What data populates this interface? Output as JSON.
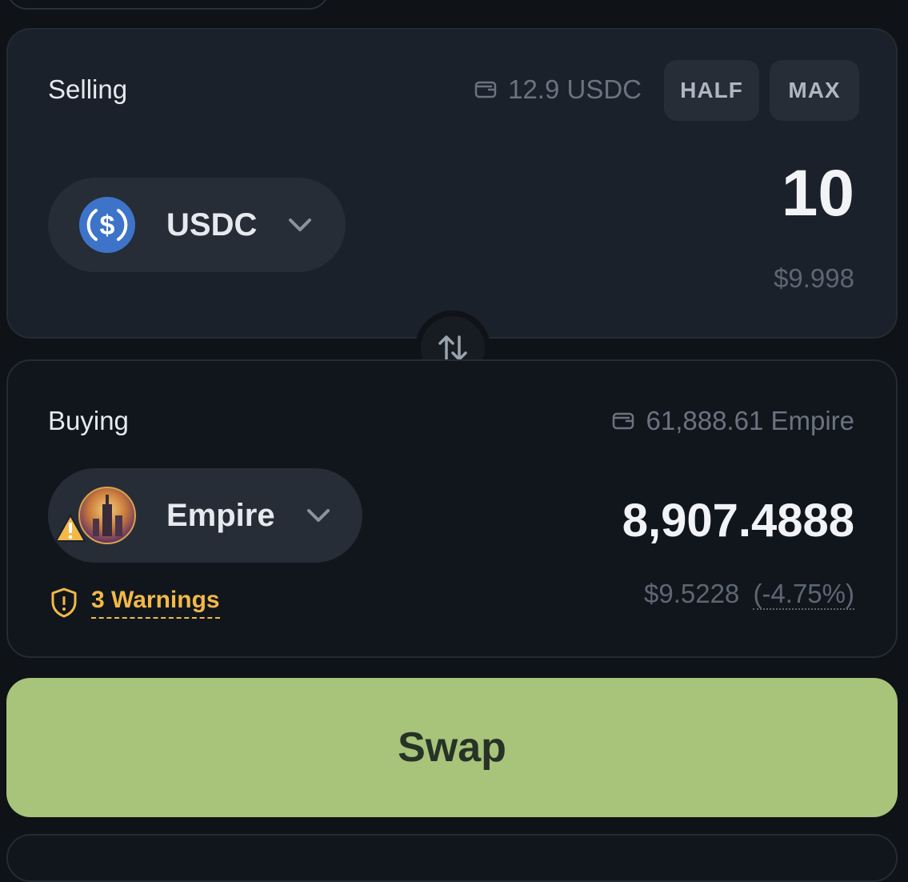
{
  "selling": {
    "label": "Selling",
    "balance": "12.9 USDC",
    "half_label": "HALF",
    "max_label": "MAX",
    "token": {
      "symbol": "USDC",
      "icon": "usdc-coin-icon",
      "color": "#3d74c9"
    },
    "amount": "10",
    "usd_value": "$9.998"
  },
  "switch": {
    "icon": "swap-arrows-icon"
  },
  "buying": {
    "label": "Buying",
    "balance": "61,888.61 Empire",
    "token": {
      "symbol": "Empire",
      "icon": "empire-token-icon"
    },
    "amount": "8,907.4888",
    "usd_value": "$9.5228",
    "price_impact": "(-4.75%)",
    "warnings": "3 Warnings"
  },
  "swap_button": {
    "label": "Swap",
    "color": "#a8c37a"
  },
  "colors": {
    "warning": "#f3b848",
    "card_sell": "#1b212a",
    "card_buy": "#11161c"
  }
}
